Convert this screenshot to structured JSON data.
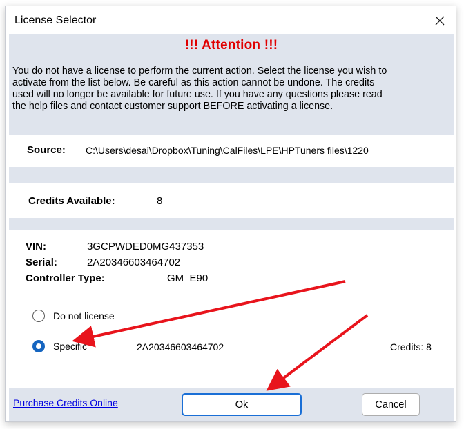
{
  "window": {
    "title": "License Selector"
  },
  "attention": {
    "heading": "!!!  Attention  !!!",
    "lines": [
      "You do not have a license to perform the current action. Select the license you wish to",
      "activate from the list below. Be careful as this action cannot be undone. The credits",
      "used will no longer be available for future use. If you have any questions please read",
      "the help files and contact customer support BEFORE activating a license."
    ]
  },
  "source": {
    "label": "Source:",
    "value": "C:\\Users\\desai\\Dropbox\\Tuning\\CalFiles\\LPE\\HPTuners files\\1220"
  },
  "credits": {
    "label": "Credits Available:",
    "value": "8"
  },
  "vehicle": {
    "vin_label": "VIN:",
    "vin_value": "3GCPWDED0MG437353",
    "serial_label": "Serial:",
    "serial_value": "2A20346603464702",
    "controller_label": "Controller Type:",
    "controller_value": "GM_E90"
  },
  "options": {
    "do_not_license": {
      "label": "Do not license",
      "selected": false
    },
    "specific": {
      "label": "Specific",
      "serial": "2A20346603464702",
      "credits_text": "Credits: 8",
      "selected": true
    }
  },
  "footer": {
    "purchase_link": "Purchase Credits Online",
    "ok_label": "Ok",
    "cancel_label": "Cancel"
  },
  "colors": {
    "attention": "#e00000",
    "panel": "#dfe4ed",
    "annotation_arrow": "#e8141c",
    "radio_selected": "#1565c0"
  },
  "icons": {
    "close": "close-icon"
  }
}
